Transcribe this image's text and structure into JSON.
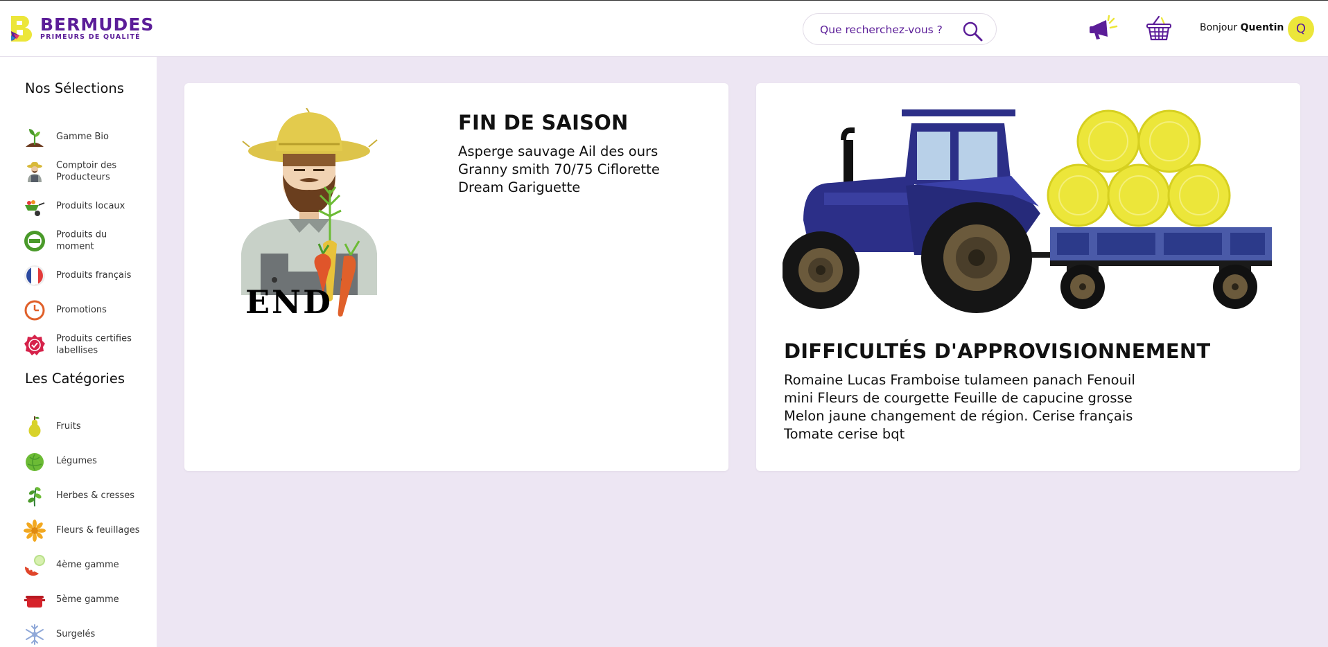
{
  "brand": {
    "name": "BERMUDES",
    "tagline": "PRIMEURS DE QUALITÉ",
    "colors": {
      "primary": "#5b1d98",
      "accent": "#ece63a",
      "background": "#ede6f3"
    }
  },
  "search": {
    "placeholder": "Que recherchez-vous ?"
  },
  "user": {
    "greeting": "Bonjour",
    "name": "Quentin",
    "initial": "Q"
  },
  "icons": {
    "header": [
      "search-icon",
      "megaphone-icon",
      "basket-icon"
    ]
  },
  "sidebar": {
    "selections_title": "Nos Sélections",
    "selections": [
      {
        "label": "Gamme Bio",
        "icon": "sprout-icon"
      },
      {
        "label": "Comptoir des Producteurs",
        "icon": "farmer-icon"
      },
      {
        "label": "Produits locaux",
        "icon": "wheelbarrow-icon"
      },
      {
        "label": "Produits du moment",
        "icon": "new-badge-icon"
      },
      {
        "label": "Produits français",
        "icon": "french-flag-icon"
      },
      {
        "label": "Promotions",
        "icon": "clock-icon"
      },
      {
        "label": "Produits certifies labellises",
        "icon": "certified-badge-icon"
      }
    ],
    "categories_title": "Les Catégories",
    "categories": [
      {
        "label": "Fruits",
        "icon": "pear-icon"
      },
      {
        "label": "Légumes",
        "icon": "cabbage-icon"
      },
      {
        "label": "Herbes & cresses",
        "icon": "herb-icon"
      },
      {
        "label": "Fleurs & feuillages",
        "icon": "flower-icon"
      },
      {
        "label": "4ème gamme",
        "icon": "cut-vegetables-icon"
      },
      {
        "label": "5ème gamme",
        "icon": "pot-icon"
      },
      {
        "label": "Surgelés",
        "icon": "snowflake-icon"
      }
    ]
  },
  "cards": [
    {
      "title": "FIN DE SAISON",
      "text": "Asperge sauvage Ail des ours Granny smith 70/75 Ciflorette Dream Gariguette",
      "image_caption": "END",
      "image_icon": "farmer-end-illustration"
    },
    {
      "title": "DIFFICULTÉS D'APPROVISIONNEMENT",
      "text": "Romaine Lucas Framboise tulameen panach Fenouil mini Fleurs de courgette Feuille de capucine grosse Melon jaune changement de région. Cerise français Tomate cerise bqt",
      "image_icon": "tractor-hay-illustration"
    }
  ]
}
